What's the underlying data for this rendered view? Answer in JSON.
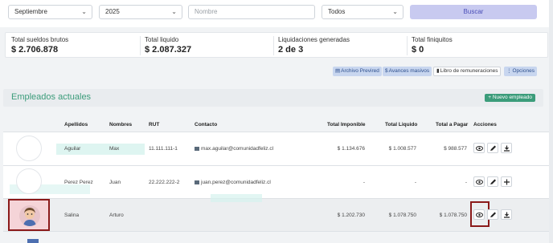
{
  "filters": {
    "month": "Septiembre",
    "year": "2025",
    "name_placeholder": "Nombre",
    "status": "Todos",
    "search_label": "Buscar"
  },
  "summary": [
    {
      "label": "Total sueldos brutos",
      "value": "$ 2.706.878"
    },
    {
      "label": "Total liquido",
      "value": "$ 2.087.327"
    },
    {
      "label": "Liquidaciones generadas",
      "value": "2 de 3"
    },
    {
      "label": "Total finiquitos",
      "value": "$ 0"
    }
  ],
  "action_buttons": {
    "previred": "Archivo Previred",
    "avances": "Avances masivos",
    "libro": "Libro de remuneraciones",
    "opciones": "Opciones"
  },
  "section": {
    "title": "Empleados actuales",
    "new_button": "+ Nuevo empleado"
  },
  "table": {
    "headers": [
      "Apellidos",
      "Nombres",
      "RUT",
      "Contacto",
      "Total Imponible",
      "Total Liquido",
      "Total a Pagar",
      "Acciones"
    ],
    "rows": [
      {
        "apellidos": "Aguilar",
        "nombres": "Max",
        "rut": "11.111.111-1",
        "contacto": "max.aguilar@comunidadfeliz.cl",
        "imponible": "$ 1.134.676",
        "liquido": "$ 1.008.577",
        "pagar": "$ 988.577",
        "third_action": "download"
      },
      {
        "apellidos": "Perez Perez",
        "nombres": "Juan",
        "rut": "22.222.222-2",
        "contacto": "juan.perez@comunidadfeliz.cl",
        "imponible": "-",
        "liquido": "-",
        "pagar": "-",
        "third_action": "add"
      },
      {
        "apellidos": "Salina",
        "nombres": "Arturo",
        "rut": "",
        "contacto": "",
        "imponible": "$ 1.202.730",
        "liquido": "$ 1.078.750",
        "pagar": "$ 1.078.750",
        "third_action": "download"
      }
    ]
  },
  "colors": {
    "accent_green": "#3b9c7a",
    "button_blue": "#c8d6ef",
    "highlight_red": "#8b1a1a",
    "search_button": "#c8caf0"
  }
}
